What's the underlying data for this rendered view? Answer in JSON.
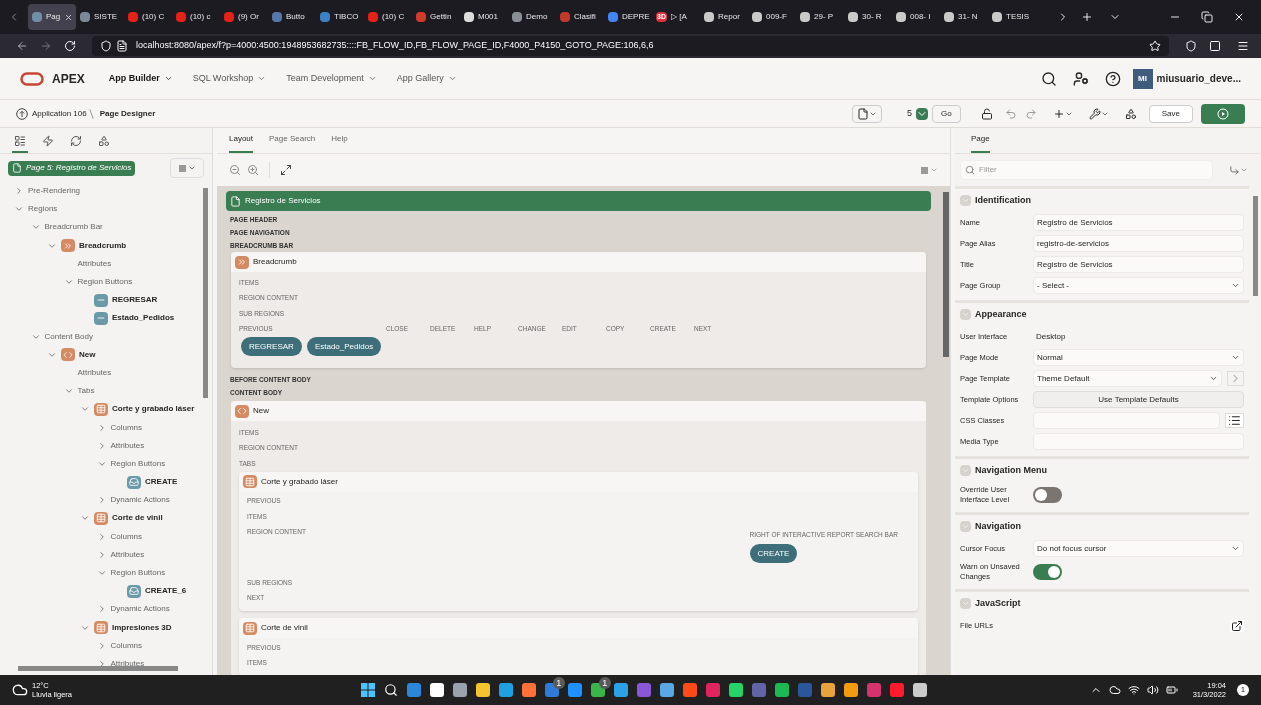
{
  "browser": {
    "tabs": [
      {
        "title": "Pag",
        "color": "#6f8fa8",
        "selected": true
      },
      {
        "title": "SISTE",
        "color": "#7a8a99",
        "selected": false
      },
      {
        "title": "(10) C",
        "color": "#e62117",
        "selected": false
      },
      {
        "title": "(10) c",
        "color": "#e62117",
        "selected": false
      },
      {
        "title": "(9) Or",
        "color": "#e62117",
        "selected": false
      },
      {
        "title": "Butto",
        "color": "#5577aa",
        "selected": false
      },
      {
        "title": "TIBCO",
        "color": "#3b82c4",
        "selected": false
      },
      {
        "title": "(10) C",
        "color": "#e62117",
        "selected": false
      },
      {
        "title": "Gettin",
        "color": "#d43a2a",
        "selected": false
      },
      {
        "title": "M001",
        "color": "#dddddd",
        "selected": false
      },
      {
        "title": "Demo",
        "color": "#8a8f96",
        "selected": false
      },
      {
        "title": "Clasifi",
        "color": "#c0392b",
        "selected": false
      },
      {
        "title": "DEPRE",
        "color": "#4285f4",
        "selected": false
      },
      {
        "title": "▷ [A",
        "color": "#e0303a",
        "icon_text": "3D",
        "selected": false
      },
      {
        "title": "Repor",
        "color": "#c9c9c9",
        "selected": false
      },
      {
        "title": "009-F",
        "color": "#c9c9c9",
        "selected": false
      },
      {
        "title": "29- P",
        "color": "#c9c9c9",
        "selected": false
      },
      {
        "title": "30- R",
        "color": "#c9c9c9",
        "selected": false
      },
      {
        "title": "008- I",
        "color": "#c9c9c9",
        "selected": false
      },
      {
        "title": "31- N",
        "color": "#c9c9c9",
        "selected": false
      },
      {
        "title": "TESIS",
        "color": "#c9c9c9",
        "selected": false
      }
    ],
    "url": "localhost:8080/apex/f?p=4000:4500:1948953682735::::FB_FLOW_ID,FB_FLOW_PAGE_ID,F4000_P4150_GOTO_PAGE:106,6,6"
  },
  "header": {
    "product": "APEX",
    "nav": [
      {
        "label": "App Builder",
        "selected": true
      },
      {
        "label": "SQL Workshop",
        "selected": false
      },
      {
        "label": "Team Development",
        "selected": false
      },
      {
        "label": "App Gallery",
        "selected": false
      }
    ],
    "avatar": "MI",
    "user": "miusuario_deve..."
  },
  "toolbar": {
    "breadcrumb": [
      "Application 106",
      "Page Designer"
    ],
    "page_number": "5",
    "go": "Go",
    "save": "Save"
  },
  "sidebar": {
    "view_tabs": [
      {
        "kind": "rendering",
        "selected": true
      },
      {
        "kind": "dynamic_actions",
        "selected": false
      },
      {
        "kind": "processing",
        "selected": false
      },
      {
        "kind": "shared",
        "selected": false
      }
    ],
    "page_label": "Page 5: Registro de Servicios",
    "tree": [
      {
        "label": "Pre-Rendering",
        "expanded": false
      },
      {
        "label": "Regions",
        "expanded": true,
        "children": [
          {
            "label": "Breadcrumb Bar",
            "expanded": true,
            "children": [
              {
                "label": "Breadcrumb",
                "kind": "breadcrumb",
                "expanded": true,
                "children": [
                  {
                    "label": "Attributes"
                  },
                  {
                    "label": "Region Buttons",
                    "expanded": true,
                    "children": [
                      {
                        "label": "REGRESAR",
                        "kind": "button"
                      },
                      {
                        "label": "Estado_Pedidos",
                        "kind": "button"
                      }
                    ]
                  }
                ]
              }
            ]
          },
          {
            "label": "Content Body",
            "expanded": true,
            "children": [
              {
                "label": "New",
                "kind": "code",
                "expanded": true,
                "children": [
                  {
                    "label": "Attributes"
                  },
                  {
                    "label": "Tabs",
                    "expanded": true,
                    "children": [
                      {
                        "label": "Corte y grabado láser",
                        "kind": "report",
                        "expanded": true,
                        "children": [
                          {
                            "label": "Columns",
                            "expanded": false
                          },
                          {
                            "label": "Attributes",
                            "expanded": false
                          },
                          {
                            "label": "Region Buttons",
                            "expanded": true,
                            "children": [
                              {
                                "label": "CREATE",
                                "kind": "create"
                              }
                            ]
                          },
                          {
                            "label": "Dynamic Actions",
                            "expanded": false
                          }
                        ]
                      },
                      {
                        "label": "Corte de vinil",
                        "kind": "report",
                        "expanded": true,
                        "children": [
                          {
                            "label": "Columns",
                            "expanded": false
                          },
                          {
                            "label": "Attributes",
                            "expanded": false
                          },
                          {
                            "label": "Region Buttons",
                            "expanded": true,
                            "children": [
                              {
                                "label": "CREATE_6",
                                "kind": "create"
                              }
                            ]
                          },
                          {
                            "label": "Dynamic Actions",
                            "expanded": false
                          }
                        ]
                      },
                      {
                        "label": "Impresiones 3D",
                        "kind": "report",
                        "expanded": true,
                        "children": [
                          {
                            "label": "Columns",
                            "expanded": false
                          },
                          {
                            "label": "Attributes",
                            "expanded": false
                          }
                        ]
                      }
                    ]
                  }
                ]
              }
            ]
          }
        ]
      }
    ]
  },
  "layout": {
    "tabs": [
      {
        "label": "Layout",
        "selected": true
      },
      {
        "label": "Page Search",
        "selected": false
      },
      {
        "label": "Help",
        "selected": false
      }
    ],
    "page_title": "Registro de Servicios",
    "positions_top": [
      "PAGE HEADER",
      "PAGE NAVIGATION",
      "BREADCRUMB BAR"
    ],
    "breadcrumb_region": {
      "title": "Breadcrumb",
      "slots": [
        "ITEMS",
        "REGION CONTENT",
        "SUB REGIONS"
      ],
      "button_positions": [
        "PREVIOUS",
        "CLOSE",
        "DELETE",
        "HELP",
        "CHANGE",
        "EDIT",
        "COPY",
        "CREATE",
        "NEXT"
      ],
      "buttons": [
        "REGRESAR",
        "Estado_Pedidos"
      ]
    },
    "positions_mid": [
      "BEFORE CONTENT BODY",
      "CONTENT BODY"
    ],
    "content_region": {
      "title": "New",
      "slots": [
        "ITEMS",
        "REGION CONTENT",
        "TABS"
      ],
      "subregions": [
        {
          "title": "Corte y grabado láser",
          "slots_top": [
            "PREVIOUS",
            "ITEMS",
            "REGION CONTENT"
          ],
          "side_position": "RIGHT OF INTERACTIVE REPORT SEARCH BAR",
          "side_buttons": [
            "CREATE"
          ],
          "slots_bottom": [
            "SUB REGIONS",
            "NEXT"
          ]
        },
        {
          "title": "Corte de vinil",
          "slots_top": [
            "PREVIOUS",
            "ITEMS"
          ]
        }
      ]
    }
  },
  "properties": {
    "tab": "Page",
    "filter_placeholder": "Filter",
    "sections": [
      {
        "title": "Identification",
        "expanded": true,
        "rows": [
          {
            "label": "Name",
            "kind": "text",
            "value": "Registro de Servicios"
          },
          {
            "label": "Page Alias",
            "kind": "text",
            "value": "registro-de-servicios"
          },
          {
            "label": "Title",
            "kind": "text",
            "value": "Registro de Servicios"
          },
          {
            "label": "Page Group",
            "kind": "select",
            "value": "- Select -"
          }
        ]
      },
      {
        "title": "Appearance",
        "expanded": true,
        "rows": [
          {
            "label": "User Interface",
            "kind": "static",
            "value": "Desktop"
          },
          {
            "label": "Page Mode",
            "kind": "select",
            "value": "Normal"
          },
          {
            "label": "Page Template",
            "kind": "select_nav",
            "value": "Theme Default"
          },
          {
            "label": "Template Options",
            "kind": "button",
            "value": "Use Template Defaults"
          },
          {
            "label": "CSS Classes",
            "kind": "text_picker"
          },
          {
            "label": "Media Type",
            "kind": "text"
          }
        ]
      },
      {
        "title": "Navigation Menu",
        "expanded": true,
        "rows": [
          {
            "label": "Override User Interface Level",
            "kind": "switch",
            "on": false
          }
        ]
      },
      {
        "title": "Navigation",
        "expanded": true,
        "rows": [
          {
            "label": "Cursor Focus",
            "kind": "select",
            "value": "Do not focus cursor"
          },
          {
            "label": "Warn on Unsaved Changes",
            "kind": "switch",
            "on": true
          }
        ]
      },
      {
        "title": "JavaScript",
        "expanded": true,
        "rows": [
          {
            "label": "File URLs",
            "kind": "url"
          }
        ]
      }
    ]
  },
  "taskbar": {
    "temperature": "12°C",
    "weather": "Lluvia ligera",
    "apps": [
      {
        "color": "#2b88d8"
      },
      {
        "color": "#ffffff"
      },
      {
        "color": "#9aa3ad"
      },
      {
        "color": "#f4c430"
      },
      {
        "color": "#1fa0e0"
      },
      {
        "color": "#ff7139"
      },
      {
        "color": "#2f7ad8",
        "badge": "1"
      },
      {
        "color": "#1e90ff"
      },
      {
        "color": "#39b54a",
        "badge": "1"
      },
      {
        "color": "#2da1e8"
      },
      {
        "color": "#8a57d6"
      },
      {
        "color": "#5aa7e6"
      },
      {
        "color": "#ff4a17"
      },
      {
        "color": "#e0245e"
      },
      {
        "color": "#25d366"
      },
      {
        "color": "#6264a7"
      },
      {
        "color": "#1db954"
      },
      {
        "color": "#2b579a"
      },
      {
        "color": "#e8a33d"
      },
      {
        "color": "#f39c12"
      },
      {
        "color": "#d6336c"
      },
      {
        "color": "#ff1b2d"
      },
      {
        "color": "#cccccc"
      }
    ],
    "time": "19:04",
    "date": "31/3/2022",
    "notifications": "1"
  }
}
